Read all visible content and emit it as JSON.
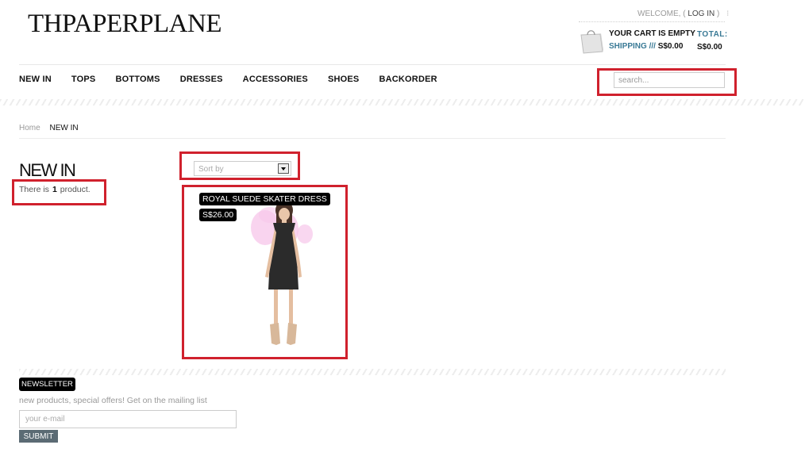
{
  "header": {
    "logo": "THPAPERPLANE",
    "welcome": "WELCOME, (",
    "login": "LOG IN",
    "welcome_close": ")",
    "separator": "⁝",
    "cart_empty": "YOUR CART IS EMPTY",
    "shipping_label": "SHIPPING ///",
    "shipping_amount": "S$0.00",
    "total_label": "TOTAL:",
    "total_value": "S$0.00"
  },
  "nav": {
    "items": [
      "NEW IN",
      "TOPS",
      "BOTTOMS",
      "DRESSES",
      "ACCESSORIES",
      "SHOES",
      "BACKORDER"
    ]
  },
  "search": {
    "placeholder": "search..."
  },
  "breadcrumb": {
    "home": "Home",
    "current": "NEW IN"
  },
  "category": {
    "title": "NEW IN",
    "count_prefix": "There is",
    "count_value": "1",
    "count_suffix": "product.",
    "sort_placeholder": "Sort by"
  },
  "products": [
    {
      "name": "ROYAL SUEDE SKATER DRESS",
      "price": "S$26.00"
    }
  ],
  "newsletter": {
    "title": "NEWSLETTER",
    "text": "new products, special offers! Get on the mailing list",
    "email_placeholder": "your e-mail",
    "submit_label": "SUBMIT"
  },
  "colors": {
    "highlight": "#d0212d",
    "link_blue": "#3a7a96",
    "submit_bg": "#5b6b74"
  }
}
